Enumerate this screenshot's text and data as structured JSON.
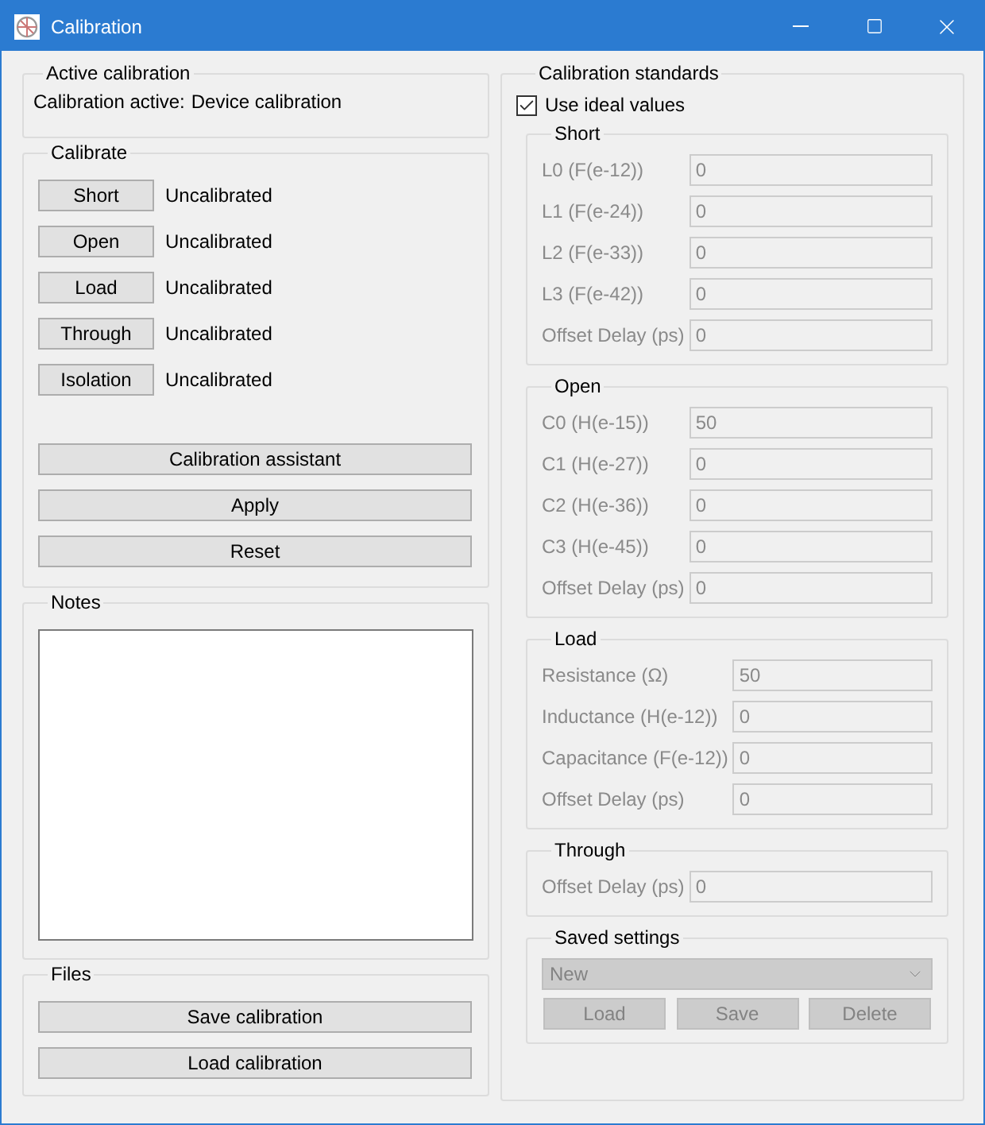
{
  "window": {
    "title": "Calibration"
  },
  "active_calibration": {
    "title": "Active calibration",
    "label": "Calibration active:",
    "value": "Device calibration"
  },
  "calibrate": {
    "title": "Calibrate",
    "standards": [
      {
        "button": "Short",
        "status": "Uncalibrated"
      },
      {
        "button": "Open",
        "status": "Uncalibrated"
      },
      {
        "button": "Load",
        "status": "Uncalibrated"
      },
      {
        "button": "Through",
        "status": "Uncalibrated"
      },
      {
        "button": "Isolation",
        "status": "Uncalibrated"
      }
    ],
    "actions": [
      "Calibration assistant",
      "Apply",
      "Reset"
    ]
  },
  "notes": {
    "title": "Notes"
  },
  "files": {
    "title": "Files",
    "buttons": [
      "Save calibration",
      "Load calibration"
    ]
  },
  "standards": {
    "title": "Calibration standards",
    "use_ideal_values": {
      "label": "Use ideal values",
      "checked": true
    },
    "groups": [
      {
        "title": "Short",
        "fields": [
          {
            "label": "L0 (F(e-12))",
            "value": "0"
          },
          {
            "label": "L1 (F(e-24))",
            "value": "0"
          },
          {
            "label": "L2 (F(e-33))",
            "value": "0"
          },
          {
            "label": "L3 (F(e-42))",
            "value": "0"
          },
          {
            "label": "Offset Delay (ps)",
            "value": "0"
          }
        ]
      },
      {
        "title": "Open",
        "fields": [
          {
            "label": "C0 (H(e-15))",
            "value": "50"
          },
          {
            "label": "C1 (H(e-27))",
            "value": "0"
          },
          {
            "label": "C2 (H(e-36))",
            "value": "0"
          },
          {
            "label": "C3 (H(e-45))",
            "value": "0"
          },
          {
            "label": "Offset Delay (ps)",
            "value": "0"
          }
        ]
      },
      {
        "title": "Load",
        "fields": [
          {
            "label": "Resistance (Ω)",
            "value": "50"
          },
          {
            "label": "Inductance (H(e-12))",
            "value": "0"
          },
          {
            "label": "Capacitance (F(e-12))",
            "value": "0"
          },
          {
            "label": "Offset Delay (ps)",
            "value": "0"
          }
        ]
      },
      {
        "title": "Through",
        "fields": [
          {
            "label": "Offset Delay (ps)",
            "value": "0"
          }
        ]
      }
    ],
    "saved_settings": {
      "title": "Saved settings",
      "selection": "New",
      "disabled": true,
      "buttons": [
        "Load",
        "Save",
        "Delete"
      ]
    }
  }
}
